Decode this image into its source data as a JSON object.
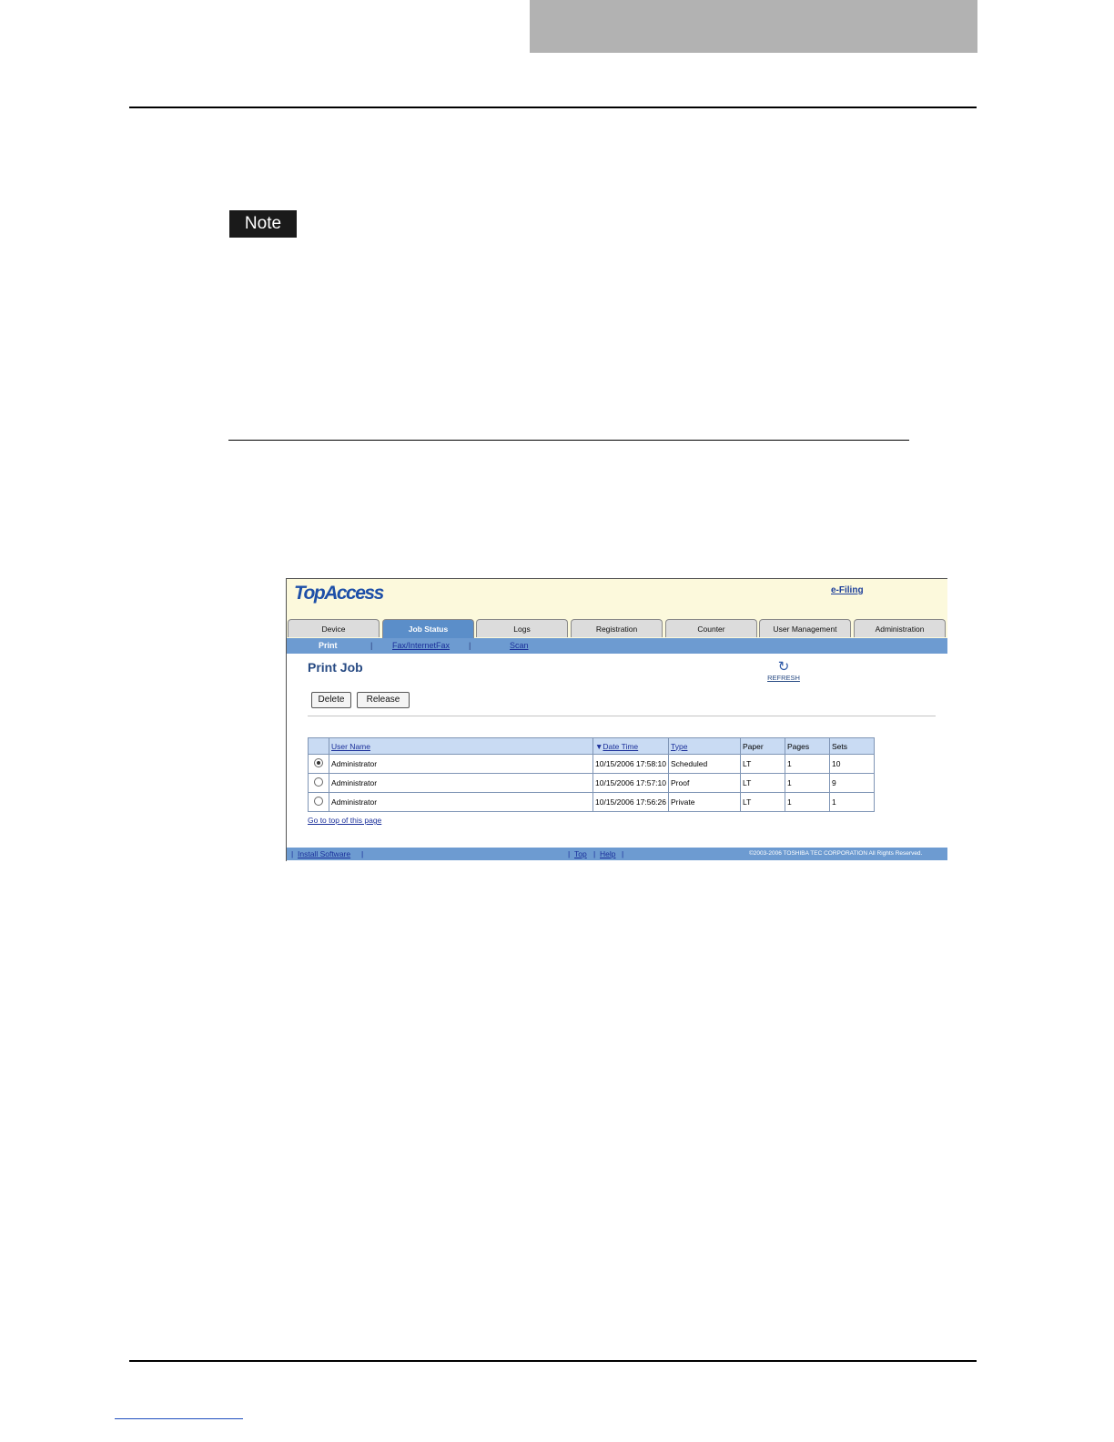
{
  "note": {
    "label": "Note"
  },
  "screenshot": {
    "logo": "TopAccess",
    "efiling": "e-Filing",
    "tabs": [
      "Device",
      "Job Status",
      "Logs",
      "Registration",
      "Counter",
      "User Management",
      "Administration"
    ],
    "active_tab": "Job Status",
    "subnav": {
      "print": "Print",
      "fax": "Fax/InternetFax",
      "scan": "Scan",
      "sep": "|"
    },
    "page_title": "Print Job",
    "refresh": {
      "icon": "refresh-icon",
      "label": "REFRESH"
    },
    "buttons": {
      "delete": "Delete",
      "release": "Release"
    },
    "table": {
      "headers": {
        "user": "User Name",
        "datetime": "Date Time",
        "type": "Type",
        "paper": "Paper",
        "pages": "Pages",
        "sets": "Sets"
      },
      "rows": [
        {
          "user": "Administrator",
          "datetime": "10/15/2006 17:58:10",
          "type": "Scheduled",
          "paper": "LT",
          "pages": "1",
          "sets": "10",
          "selected": true
        },
        {
          "user": "Administrator",
          "datetime": "10/15/2006 17:57:10",
          "type": "Proof",
          "paper": "LT",
          "pages": "1",
          "sets": "9",
          "selected": false
        },
        {
          "user": "Administrator",
          "datetime": "10/15/2006 17:56:26",
          "type": "Private",
          "paper": "LT",
          "pages": "1",
          "sets": "1",
          "selected": false
        }
      ]
    },
    "go_top": "Go to top of this page",
    "footer": {
      "install": "Install Software",
      "top": "Top",
      "help": "Help",
      "bar": "|",
      "copyright": "©2003-2006 TOSHIBA TEC CORPORATION All Rights Reserved."
    }
  },
  "colors": {
    "header_block": "#b2b2b2",
    "nav_blue": "#6d9bd1",
    "banner": "#fcf9dc"
  }
}
